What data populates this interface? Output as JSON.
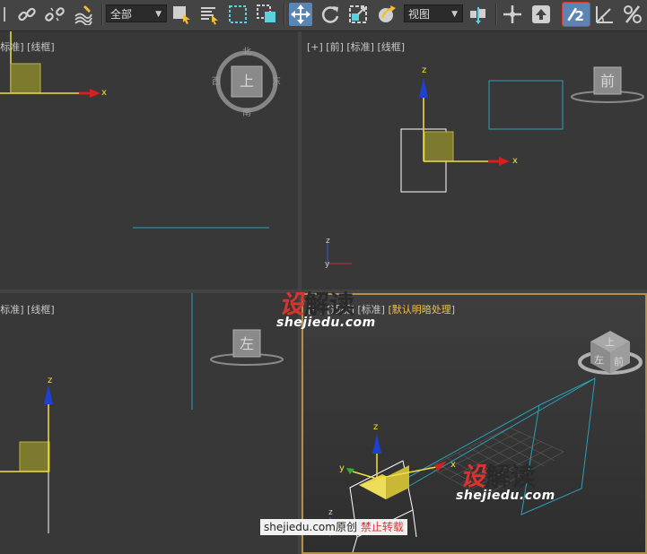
{
  "toolbar": {
    "selection_filter": "全部",
    "reference_coord": "视图",
    "snap_value": "2",
    "colors": {
      "active": "#5b86b3",
      "snap_outline": "#e23434"
    }
  },
  "viewports": {
    "top": {
      "label": "[标准] [线框]",
      "viewcube_face": "上",
      "compass": {
        "north": "北",
        "south": "南",
        "east": "东",
        "west": "西"
      },
      "axis_x": "x"
    },
    "front": {
      "label": "[+] [前] [标准] [线框]",
      "viewcube_face": "前",
      "axis_x": "x",
      "axis_z": "z",
      "mini_axis_z": "z",
      "mini_axis_y": "y"
    },
    "left": {
      "label": "[标准] [线框]",
      "viewcube_face": "左",
      "axis_z": "z"
    },
    "perspective": {
      "label_plain": "[+] [透视] [标准]",
      "label_highlight": "[默认明暗处理]",
      "viewcube_face_top": "上",
      "viewcube_face_front": "前",
      "viewcube_face_left": "左",
      "axis_x": "x",
      "axis_y": "y",
      "axis_z": "z",
      "mini_axis_z": "z"
    }
  },
  "watermarks": {
    "logo_part1": "设",
    "logo_part2": "解读",
    "url": "shejiedu.com"
  },
  "copyright": {
    "site": "shejiedu.com",
    "original": "原创",
    "no_repost": "禁止转载"
  }
}
